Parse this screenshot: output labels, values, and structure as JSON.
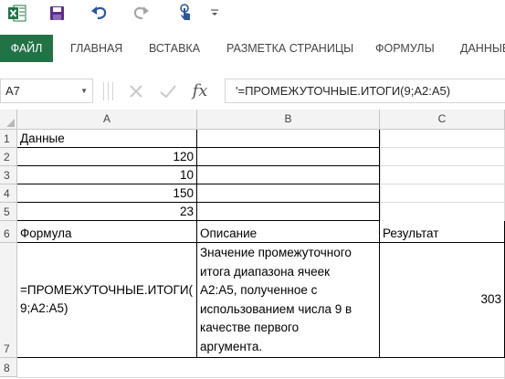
{
  "colors": {
    "excel_green": "#217346",
    "save_purple": "#5b2d8e",
    "qat_blue": "#2b579a"
  },
  "toolbar": {
    "icons": [
      "excel-logo-icon",
      "save-icon",
      "undo-icon",
      "redo-icon",
      "touch-mode-icon",
      "customize-toolbar-icon"
    ]
  },
  "ribbon": {
    "tabs": [
      "ФАЙЛ",
      "ГЛАВНАЯ",
      "ВСТАВКА",
      "РАЗМЕТКА СТРАНИЦЫ",
      "ФОРМУЛЫ",
      "ДАННЫЕ"
    ]
  },
  "formula_bar": {
    "name_box": "A7",
    "formula": "'=ПРОМЕЖУТОЧНЫЕ.ИТОГИ(9;A2:A5)",
    "cancel_icon": "x-icon",
    "enter_icon": "check-icon",
    "function_label": "fx"
  },
  "sheet": {
    "columns": [
      "A",
      "B",
      "C"
    ],
    "rows": [
      "1",
      "2",
      "3",
      "4",
      "5",
      "6",
      "7",
      "8"
    ],
    "cells": {
      "A1": "Данные",
      "A2": "120",
      "A3": "10",
      "A4": "150",
      "A5": "23",
      "A6": "Формула",
      "B6": "Описание",
      "C6": "Результат",
      "A7": "=ПРОМЕЖУТОЧНЫЕ.ИТОГИ(\n9;A2:A5)",
      "B7": "Значение промежуточного\nитога диапазона ячеек\nA2:A5, полученное с\nиспользованием числа 9 в\nкачестве первого\nаргумента.",
      "C7": "303"
    }
  }
}
